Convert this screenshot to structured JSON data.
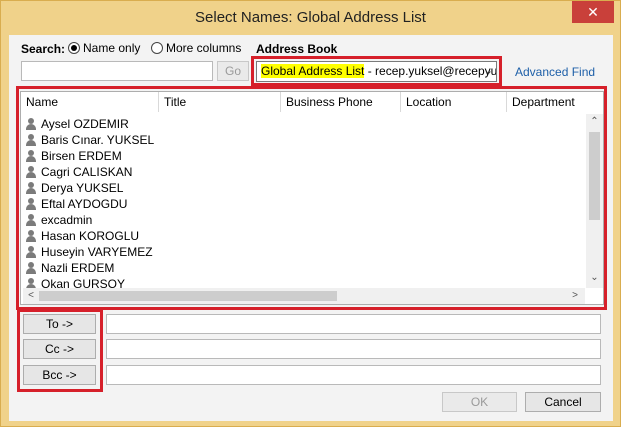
{
  "window": {
    "title": "Select Names: Global Address List",
    "close_glyph": "✕"
  },
  "search": {
    "label": "Search:",
    "option_name_only": "Name only",
    "option_more_columns": "More columns",
    "input_value": "",
    "go_label": "Go"
  },
  "address_book": {
    "label": "Address Book",
    "selected_highlight": "Global Address List",
    "selected_rest": " - recep.yuksel@recepyu",
    "advanced_find": "Advanced Find"
  },
  "columns": [
    "Name",
    "Title",
    "Business Phone",
    "Location",
    "Department"
  ],
  "entries": [
    "Aysel OZDEMIR",
    "Baris Cınar. YUKSEL",
    "Birsen ERDEM",
    "Cagri CALISKAN",
    "Derya YUKSEL",
    "Eftal AYDOGDU",
    "excadmin",
    "Hasan KOROGLU",
    "Huseyin VARYEMEZ",
    "Nazli ERDEM",
    "Okan GURSOY"
  ],
  "recipients": {
    "to_label": "To ->",
    "cc_label": "Cc ->",
    "bcc_label": "Bcc ->",
    "to_value": "",
    "cc_value": "",
    "bcc_value": ""
  },
  "footer": {
    "ok_label": "OK",
    "cancel_label": "Cancel"
  },
  "colors": {
    "highlight": "#ffff00",
    "annotation_red": "#d6202a",
    "link": "#1d5fa8",
    "titlebar": "#f0d28a"
  }
}
